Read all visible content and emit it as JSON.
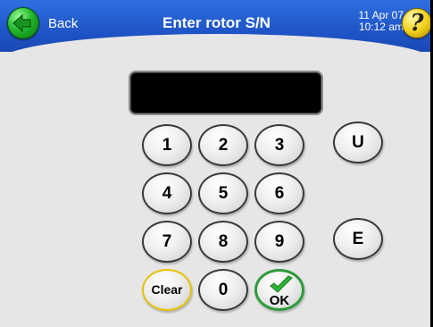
{
  "header": {
    "back_label": "Back",
    "title": "Enter rotor S/N",
    "date": "11 Apr 07",
    "time": "10:12 am",
    "help_glyph": "?"
  },
  "display": {
    "value": ""
  },
  "keypad": {
    "k1": "1",
    "k2": "2",
    "k3": "3",
    "k4": "4",
    "k5": "5",
    "k6": "6",
    "k7": "7",
    "k8": "8",
    "k9": "9",
    "k0": "0",
    "clear": "Clear",
    "ok": "OK",
    "u": "U",
    "e": "E"
  },
  "colors": {
    "header": "#1f55c7",
    "background": "#e6e6e6",
    "clear_border": "#e6c200",
    "ok_border": "#2e9a3a",
    "back_icon": "#22b82b",
    "help_icon": "#f5d31c"
  },
  "icons": {
    "back": "arrow-left-icon",
    "help": "help-icon",
    "ok": "checkmark-icon"
  }
}
